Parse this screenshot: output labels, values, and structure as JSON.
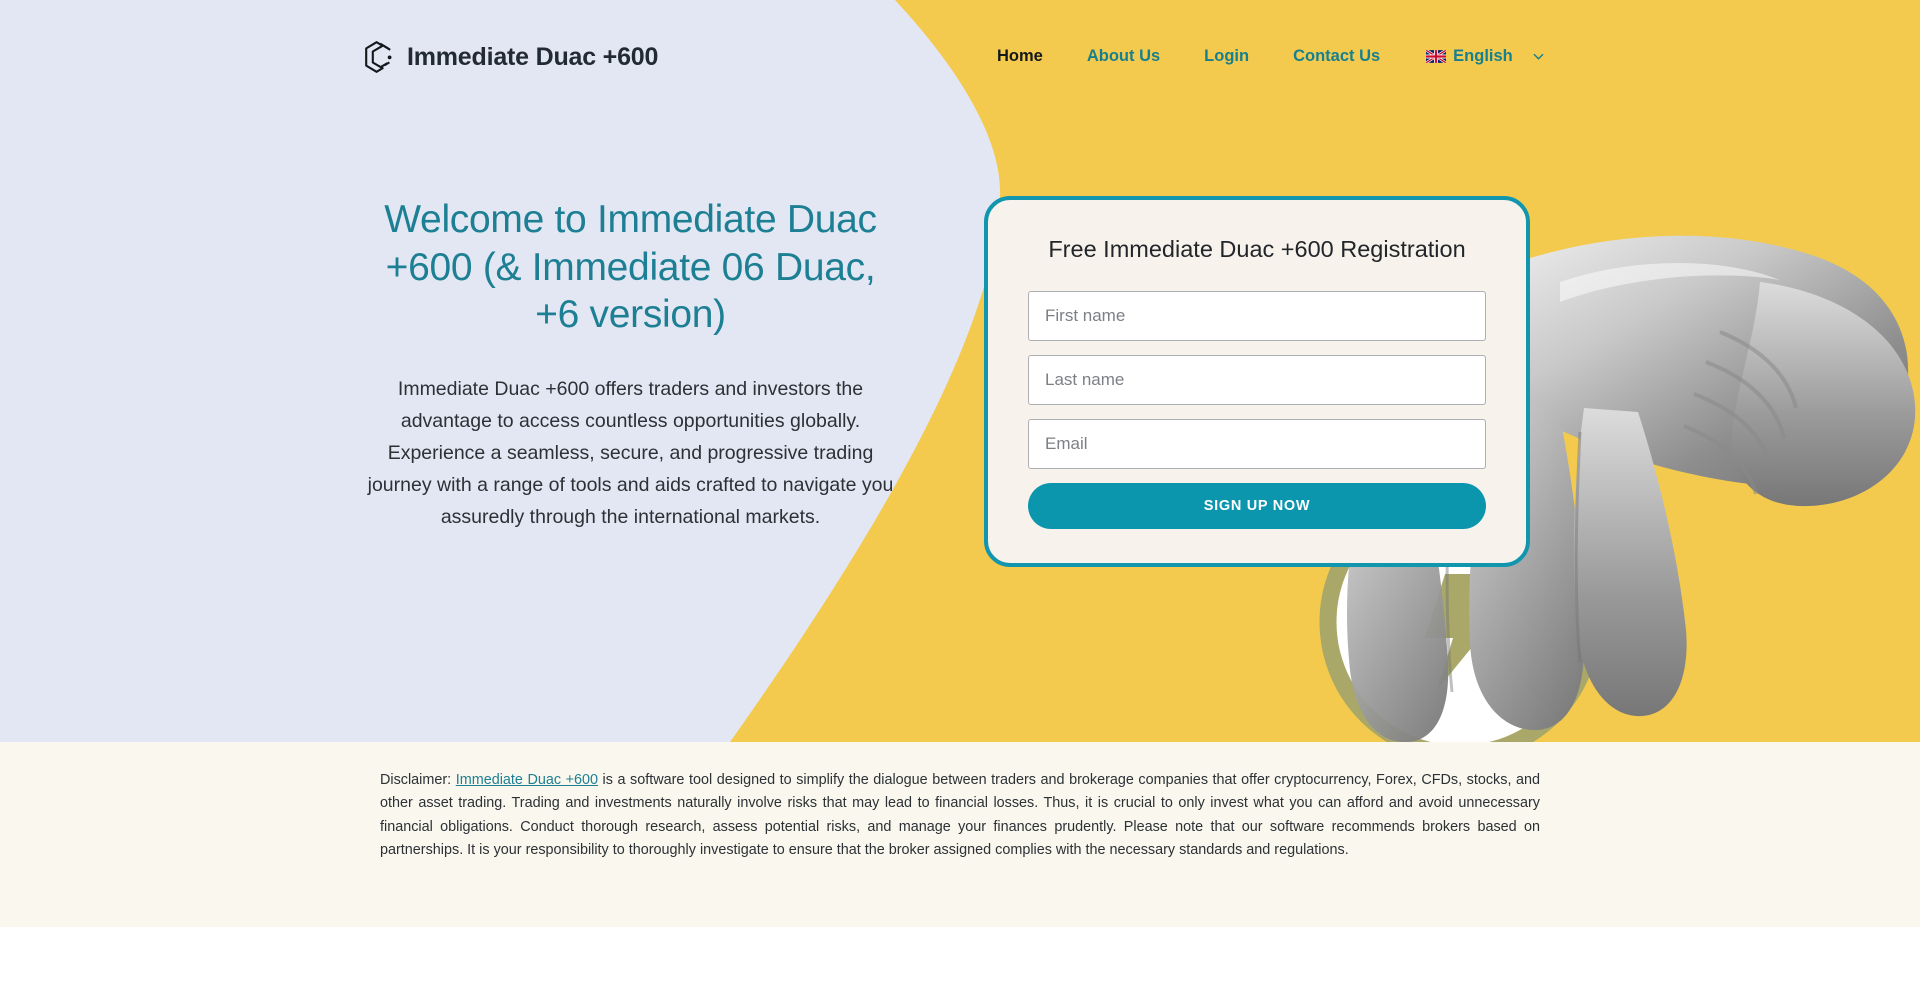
{
  "brand": {
    "name": "Immediate Duac +600",
    "logo_icon": "hexagon-c-logo-icon"
  },
  "nav": {
    "items": [
      {
        "label": "Home",
        "active": true
      },
      {
        "label": "About Us",
        "active": false
      },
      {
        "label": "Login",
        "active": false
      },
      {
        "label": "Contact Us",
        "active": false
      }
    ],
    "language": {
      "label": "English",
      "flag_icon": "uk-flag-icon",
      "chevron_icon": "chevron-down-icon"
    }
  },
  "hero": {
    "title": "Welcome to Immediate Duac +600 (& Immediate 06 Duac, +6 version)",
    "description": "Immediate Duac +600 offers traders and investors the advantage to access countless opportunities globally. Experience a seamless, secure, and progressive trading journey with a range of tools and aids crafted to navigate you assuredly through the international markets."
  },
  "form": {
    "title": "Free Immediate Duac +600 Registration",
    "first_name_placeholder": "First name",
    "first_name_value": "",
    "last_name_placeholder": "Last name",
    "last_name_value": "",
    "email_placeholder": "Email",
    "email_value": "",
    "submit_label": "SIGN UP NOW"
  },
  "disclaimer": {
    "prefix": "Disclaimer:",
    "link_text": "Immediate Duac +600",
    "body": " is a software tool designed to simplify the dialogue between traders and brokerage companies that offer cryptocurrency, Forex, CFDs, stocks, and other asset trading. Trading and investments naturally involve risks that may lead to financial losses. Thus, it is crucial to only invest what you can afford and avoid unnecessary financial obligations. Conduct thorough research, assess potential risks, and manage your finances prudently. Please note that our software recommends brokers based on partnerships. It is your responsibility to thoroughly investigate to ensure that the broker assigned complies with the necessary standards and regulations."
  },
  "colors": {
    "background_left": "#E3E7F3",
    "background_right": "#F3CA4D",
    "accent_teal": "#1196AE",
    "heading_teal": "#1d7f94",
    "card_background": "#F7F2EC",
    "disclaimer_background": "#FAF8EE",
    "text_dark": "#2c3136"
  }
}
